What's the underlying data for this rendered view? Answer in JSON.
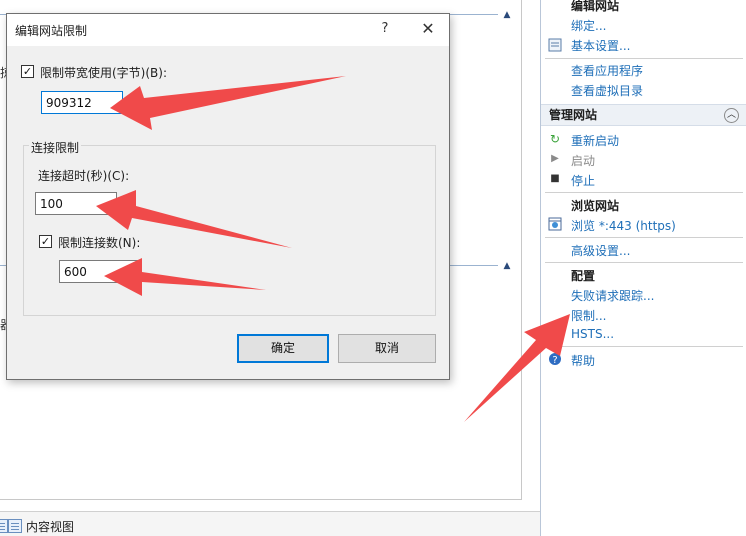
{
  "main_area": {
    "cut_glyph_1": "掠",
    "cut_glyph_2": "器"
  },
  "bottom_tabs": {
    "content_view_label": "内容视图"
  },
  "actions_pane": {
    "edit_site": {
      "title": "编辑网站",
      "bindings": "绑定...",
      "basic_settings": "基本设置...",
      "view_applications": "查看应用程序",
      "view_virtual_dirs": "查看虚拟目录"
    },
    "manage_site": {
      "header": "管理网站",
      "restart": "重新启动",
      "start": "启动",
      "stop": "停止"
    },
    "browse_site": {
      "title": "浏览网站",
      "browse_link": "浏览 *:443 (https)",
      "advanced_settings": "高级设置..."
    },
    "config": {
      "title": "配置",
      "failed_request_tracing": "失败请求跟踪...",
      "limits": "限制...",
      "hsts": "HSTS..."
    },
    "help": "帮助"
  },
  "dialog": {
    "title": "编辑网站限制",
    "help_glyph": "?",
    "close_glyph": "✕",
    "bandwidth": {
      "checked": true,
      "label": "限制带宽使用(字节)(B):",
      "value": "909312"
    },
    "connection_group": {
      "title": "连接限制",
      "timeout_label": "连接超时(秒)(C):",
      "timeout_value": "100",
      "limit_connections_checked": true,
      "limit_connections_label": "限制连接数(N):",
      "limit_connections_value": "600"
    },
    "ok_label": "确定",
    "cancel_label": "取消"
  },
  "colors": {
    "annotation_arrow": "#f04a4a",
    "link": "#1f6fb8",
    "focus_border": "#0078d7"
  }
}
